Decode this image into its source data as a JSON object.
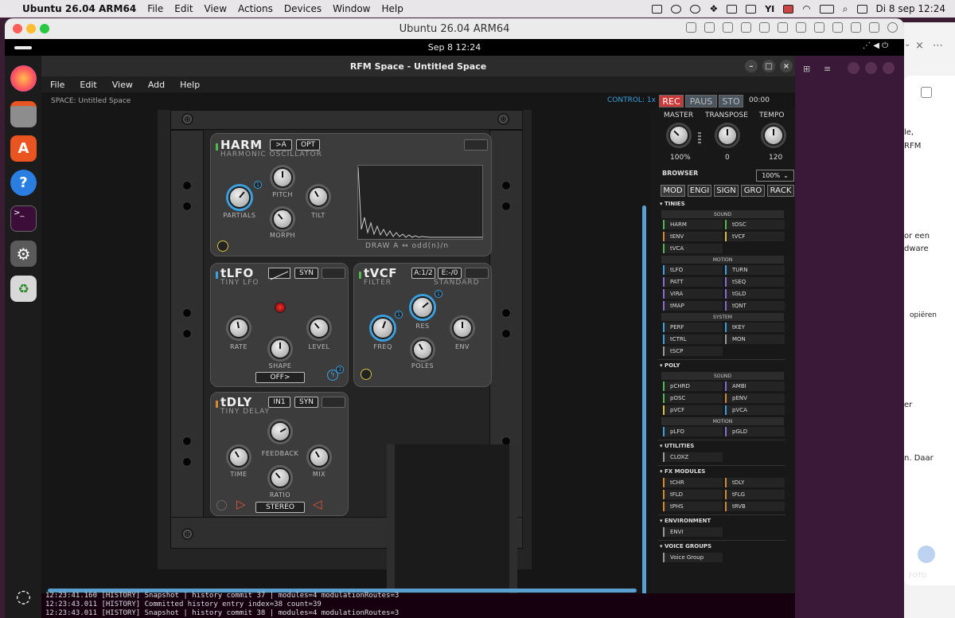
{
  "mac": {
    "app": "Ubuntu 26.04 ARM64",
    "menus": [
      "File",
      "Edit",
      "View",
      "Actions",
      "Devices",
      "Window",
      "Help"
    ],
    "clock": "Di 8 sep  12:24"
  },
  "vm": {
    "title": "Ubuntu 26.04 ARM64"
  },
  "ubuntu": {
    "clock": "Sep 8  12:24"
  },
  "rfm": {
    "title": "RFM Space - Untitled Space",
    "menu": [
      "File",
      "Edit",
      "View",
      "Add",
      "Help"
    ],
    "space": "SPACE: Untitled Space",
    "control": "CONTROL: 1x",
    "rec": "REC",
    "paus": "PAUS",
    "sto": "STO",
    "time": "00:00"
  },
  "harm": {
    "name": "HARM",
    "sub": "HARMONIC OSCILLATOR",
    "btn1": ">A",
    "btn2": "OPT",
    "knobs": [
      "PARTIALS",
      "PITCH",
      "TILT",
      "MORPH"
    ],
    "display": "DRAW A ↔ odd(n)/n"
  },
  "tlfo": {
    "name": "tLFO",
    "sub": "TINY LFO",
    "syn": "SYN",
    "knobs": [
      "RATE",
      "SHAPE",
      "LEVEL"
    ],
    "mode": "OFF>"
  },
  "tvcf": {
    "name": "tVCF",
    "sub": "FILTER",
    "sub2": "STANDARD",
    "btn1": "A:1/2",
    "btn2": "E:-/0",
    "knobs": [
      "FREQ",
      "RES",
      "POLES",
      "ENV"
    ]
  },
  "tdly": {
    "name": "tDLY",
    "sub": "TINY DELAY",
    "btn1": "IN1",
    "syn": "SYN",
    "knobs": [
      "TIME",
      "FEEDBACK",
      "RATIO",
      "MIX"
    ],
    "mode": "STEREO"
  },
  "panel": {
    "master": "MASTER",
    "transpose": "TRANSPOSE",
    "tempo": "TEMPO",
    "master_val": "100%",
    "transpose_val": "0",
    "tempo_val": "120",
    "browser": "BROWSER",
    "zoom": "100%",
    "tabs": [
      "MOD",
      "ENGI",
      "SIGN",
      "GRO",
      "RACK"
    ]
  },
  "browser": {
    "tinies": "TINIES",
    "sound": "SOUND",
    "motion": "MOTION",
    "system": "SYSTEM",
    "tinies_sound": [
      "HARM",
      "tOSC",
      "tENV",
      "tVCF",
      "tVCA"
    ],
    "tinies_motion": [
      "tLFO",
      "TURN",
      "PATT",
      "tSEQ",
      "VIRA",
      "tGLD",
      "tMAP",
      "tQNT"
    ],
    "tinies_system": [
      "PERF",
      "tKEY",
      "tCTRL",
      "MON",
      "tSCP"
    ],
    "poly": "POLY",
    "poly_sound": [
      "pCHRD",
      "AMBI",
      "pOSC",
      "pENV",
      "pVCF",
      "pVCA"
    ],
    "poly_motion": [
      "pLFO",
      "pGLD"
    ],
    "utilities": "UTILITIES",
    "util": [
      "CLOXZ"
    ],
    "fx": "FX MODULES",
    "fx_items": [
      "tCHR",
      "tDLY",
      "tFLD",
      "tFLG",
      "tPHS",
      "tRVB"
    ],
    "env": "ENVIRONMENT",
    "env_items": [
      "ENVI"
    ],
    "vg": "VOICE GROUPS",
    "vg_items": [
      "Voice Group"
    ]
  },
  "terminal": [
    "12:23:41.160 [HISTORY] Snapshot | history commit 37 | modules=4 modulationRoutes=3",
    "12:23:43.011 [HISTORY] Committed history entry index=38 count=39",
    "12:23:43.011 [HISTORY] Snapshot | history commit 38 | modules=4 modulationRoutes=3"
  ],
  "side": {
    "t1": "le,",
    "t2": "RFM",
    "t3": "or een",
    "t4": "dware",
    "t5": "opiëren",
    "t6": "er",
    "t7": "n. Daar",
    "t8": "FOTO"
  },
  "colors": {
    "accent": "#3aa0e0",
    "rec": "#c83a3a",
    "badge_yellow": "#d4c040"
  }
}
